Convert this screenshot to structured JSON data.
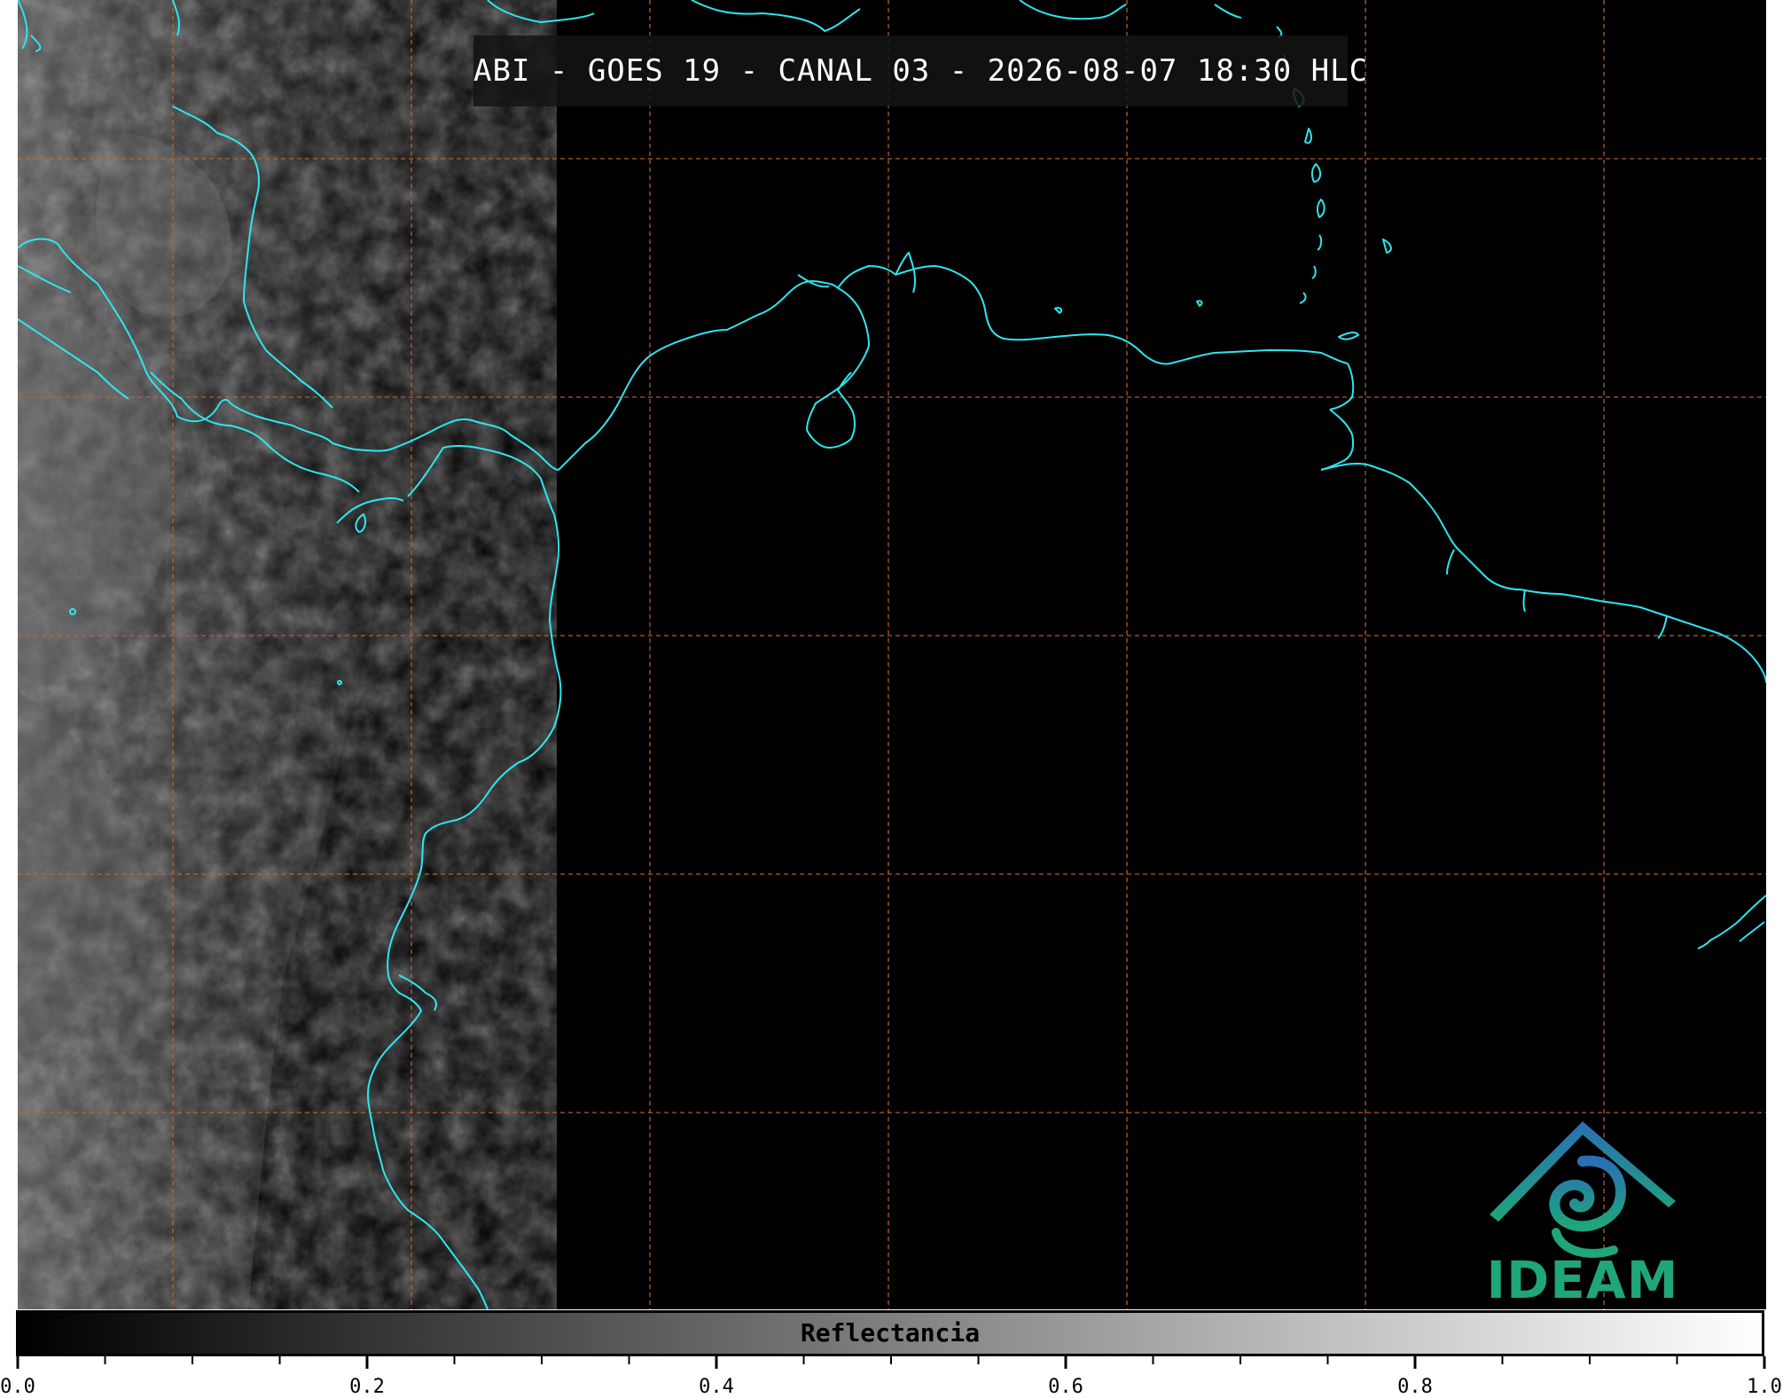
{
  "title": "ABI - GOES 19 - CANAL 03 - 2026-08-07 18:30 HLC",
  "colorbar": {
    "label": "Reflectancia",
    "range": [
      0.0,
      1.0
    ],
    "ticks": [
      "0.0",
      "0.2",
      "0.4",
      "0.6",
      "0.8",
      "1.0"
    ],
    "minor_ticks_per_step": 4,
    "colors": [
      "#000000",
      "#ffffff"
    ]
  },
  "logo": {
    "text": "IDEAM",
    "colors": [
      "#2a6fb5",
      "#1fa67a"
    ]
  },
  "map": {
    "background": "#000000",
    "coastline_color": "#2ee6ee",
    "gridline_color": "#c8662a",
    "gridline_style": "dashed",
    "cloud_region": "west"
  }
}
